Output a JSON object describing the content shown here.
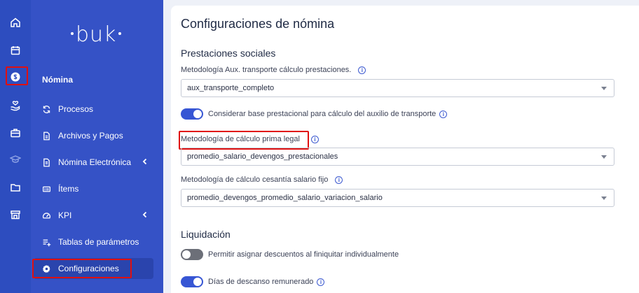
{
  "brand": {
    "logo_text": "buk"
  },
  "rail": {
    "icons": [
      "home-icon",
      "calendar-icon",
      "payroll-icon",
      "hand-heart-icon",
      "briefcase-icon",
      "graduation-cap-icon",
      "folder-icon",
      "store-icon"
    ],
    "active": "payroll-icon"
  },
  "nav": {
    "section_label": "Nómina",
    "items": [
      {
        "label": "Procesos",
        "icon": "refresh-icon"
      },
      {
        "label": "Archivos y Pagos",
        "icon": "file-icon"
      },
      {
        "label": "Nómina Electrónica",
        "icon": "document-icon",
        "has_submenu": true
      },
      {
        "label": "Ítems",
        "icon": "list-icon"
      },
      {
        "label": "KPI",
        "icon": "gauge-icon",
        "has_submenu": true
      },
      {
        "label": "Tablas de parámetros",
        "icon": "table-add-icon"
      },
      {
        "label": "Configuraciones",
        "icon": "gear-icon",
        "active": true
      }
    ]
  },
  "page": {
    "title": "Configuraciones de nómina",
    "sections": {
      "prestaciones": {
        "title": "Prestaciones sociales",
        "aux_transporte_label": "Metodología Aux. transporte cálculo prestaciones.",
        "aux_transporte_value": "aux_transporte_completo",
        "base_prestacional_label": "Considerar base prestacional para cálculo del auxilio de transporte",
        "base_prestacional_on": true,
        "prima_label": "Metodología de cálculo prima legal",
        "prima_value": "promedio_salario_devengos_prestacionales",
        "cesantia_label": "Metodología de cálculo cesantía salario fijo",
        "cesantia_value": "promedio_devengos_promedio_salario_variacion_salario"
      },
      "liquidacion": {
        "title": "Liquidación",
        "descuentos_label": "Permitir asignar descuentos al finiquitar individualmente",
        "descuentos_on": false,
        "descanso_label": "Días de descanso remunerado",
        "descanso_on": true
      }
    },
    "info_glyph": "i"
  },
  "colors": {
    "rail_bg": "#2d4dbf",
    "nav_bg": "#3552c6",
    "accent": "#3756d4",
    "highlight": "#e01010"
  }
}
